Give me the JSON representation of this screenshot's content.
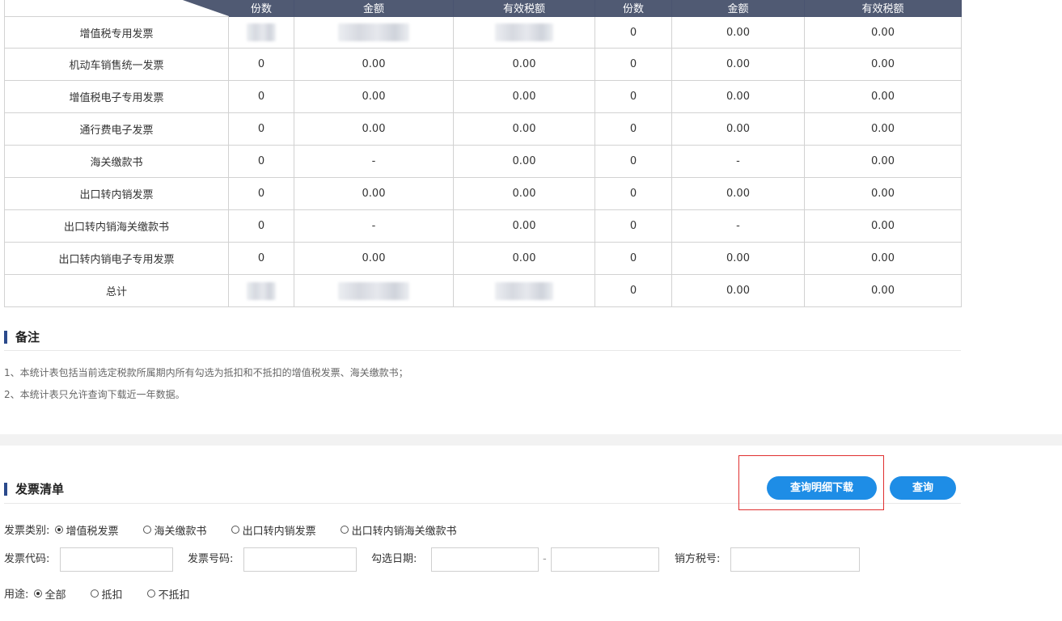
{
  "summary_table": {
    "header": [
      "份数",
      "金额",
      "有效税额",
      "份数",
      "金额",
      "有效税额"
    ],
    "rows": [
      {
        "name": "增值税专用发票",
        "c1": "",
        "c2": "",
        "c3": "",
        "c4": "0",
        "c5": "0.00",
        "c6": "0.00"
      },
      {
        "name": "机动车销售统一发票",
        "c1": "0",
        "c2": "0.00",
        "c3": "0.00",
        "c4": "0",
        "c5": "0.00",
        "c6": "0.00"
      },
      {
        "name": "增值税电子专用发票",
        "c1": "0",
        "c2": "0.00",
        "c3": "0.00",
        "c4": "0",
        "c5": "0.00",
        "c6": "0.00"
      },
      {
        "name": "通行费电子发票",
        "c1": "0",
        "c2": "0.00",
        "c3": "0.00",
        "c4": "0",
        "c5": "0.00",
        "c6": "0.00"
      },
      {
        "name": "海关缴款书",
        "c1": "0",
        "c2": "-",
        "c3": "0.00",
        "c4": "0",
        "c5": "-",
        "c6": "0.00"
      },
      {
        "name": "出口转内销发票",
        "c1": "0",
        "c2": "0.00",
        "c3": "0.00",
        "c4": "0",
        "c5": "0.00",
        "c6": "0.00"
      },
      {
        "name": "出口转内销海关缴款书",
        "c1": "0",
        "c2": "-",
        "c3": "0.00",
        "c4": "0",
        "c5": "-",
        "c6": "0.00"
      },
      {
        "name": "出口转内销电子专用发票",
        "c1": "0",
        "c2": "0.00",
        "c3": "0.00",
        "c4": "0",
        "c5": "0.00",
        "c6": "0.00"
      },
      {
        "name": "总计",
        "c1": "",
        "c2": "",
        "c3": "",
        "c4": "0",
        "c5": "0.00",
        "c6": "0.00"
      }
    ]
  },
  "notes": {
    "title": "备注",
    "line1": "1、本统计表包括当前选定税款所属期内所有勾选为抵扣和不抵扣的增值税发票、海关缴款书；",
    "line2": "2、本统计表只允许查询下载近一年数据。"
  },
  "invoice_list": {
    "title": "发票清单",
    "download_button": "查询明细下载",
    "query_button": "查询",
    "type_label": "发票类别:",
    "type_options": [
      "增值税发票",
      "海关缴款书",
      "出口转内销发票",
      "出口转内销海关缴款书"
    ],
    "type_selected": 0,
    "code_label": "发票代码:",
    "number_label": "发票号码:",
    "date_label": "勾选日期:",
    "date_sep": "-",
    "seller_label": "销方税号:",
    "usage_label": "用途:",
    "usage_options": [
      "全部",
      "抵扣",
      "不抵扣"
    ],
    "usage_selected": 0,
    "code_value": "",
    "number_value": "",
    "date_from": "",
    "date_to": "",
    "seller_value": ""
  },
  "colors": {
    "header_bg": "#505a73",
    "accent": "#1e8de6",
    "highlight": "#e03030",
    "section_bar": "#2b4a8c"
  }
}
